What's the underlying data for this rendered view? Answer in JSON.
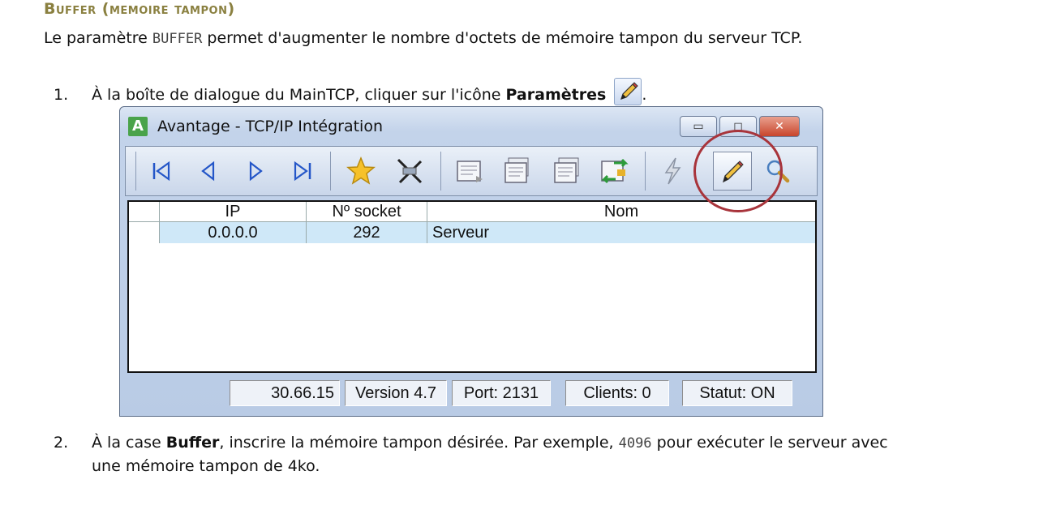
{
  "heading": "Buffer (memoire tampon)",
  "intro": {
    "before": "Le paramètre ",
    "code": "BUFFER",
    "after": " permet d'augmenter le nombre d'octets de mémoire tampon du serveur TCP."
  },
  "step1": {
    "number": "1.",
    "text": "À la boîte de dialogue du MainTCP, cliquer sur l'icône ",
    "bold": "Paramètres",
    "end": "."
  },
  "window": {
    "title": "Avantage - TCP/IP Intégration",
    "app_icon_letter": "A",
    "toolbar_icons": [
      "first-icon",
      "prev-icon",
      "next-icon",
      "last-icon",
      "star-icon",
      "disconnect-icon",
      "doc1-icon",
      "doc2-icon",
      "doc3-icon",
      "transfer-icon",
      "lightning-icon",
      "pencil-icon",
      "search-icon"
    ],
    "grid": {
      "headers": [
        "IP",
        "Nº socket",
        "Nom"
      ],
      "rows": [
        {
          "ip": "0.0.0.0",
          "socket": "292",
          "nom": "Serveur"
        }
      ]
    },
    "status": [
      "30.66.15",
      "Version 4.7",
      "Port: 2131",
      "Clients: 0",
      "Statut: ON"
    ],
    "highlight_color": "#a8343b"
  },
  "step2": {
    "number": "2.",
    "text1": "À la case ",
    "bold": "Buffer",
    "text2": ", inscrire la mémoire tampon désirée. Par exemple, ",
    "code": "4096",
    "text3": " pour exécuter le serveur avec",
    "line2": "une mémoire tampon de 4ko."
  }
}
